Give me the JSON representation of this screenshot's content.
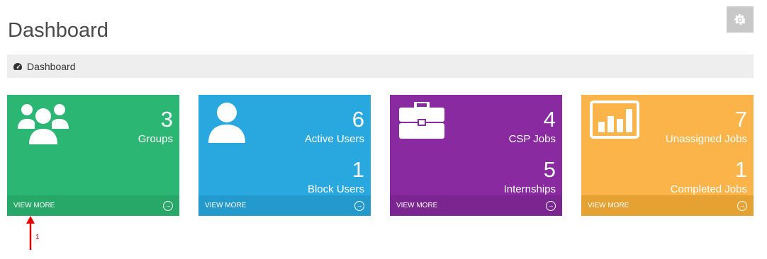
{
  "page": {
    "title": "Dashboard"
  },
  "settings": {
    "icon": "gear-icon"
  },
  "breadcrumb": {
    "icon": "dashboard-gauge-icon",
    "label": "Dashboard"
  },
  "tiles": [
    {
      "icon": "groups-icon",
      "color": "#2bb673",
      "footer_color": "#27a768",
      "stats": [
        {
          "count": "3",
          "label": "Groups"
        }
      ],
      "view_more": "VIEW MORE"
    },
    {
      "icon": "user-icon",
      "color": "#29a8e0",
      "footer_color": "#2499cc",
      "stats": [
        {
          "count": "6",
          "label": "Active Users"
        },
        {
          "count": "1",
          "label": "Block Users"
        }
      ],
      "view_more": "VIEW MORE"
    },
    {
      "icon": "briefcase-icon",
      "color": "#8a2aa0",
      "footer_color": "#7a2590",
      "stats": [
        {
          "count": "4",
          "label": "CSP Jobs"
        },
        {
          "count": "5",
          "label": "Internships"
        }
      ],
      "view_more": "VIEW MORE"
    },
    {
      "icon": "bar-chart-icon",
      "color": "#fbb44a",
      "footer_color": "#e6a133",
      "stats": [
        {
          "count": "7",
          "label": "Unassigned Jobs"
        },
        {
          "count": "1",
          "label": "Completed Jobs"
        }
      ],
      "view_more": "VIEW MORE"
    }
  ],
  "annotation": {
    "label": "1",
    "color": "#e00000"
  }
}
